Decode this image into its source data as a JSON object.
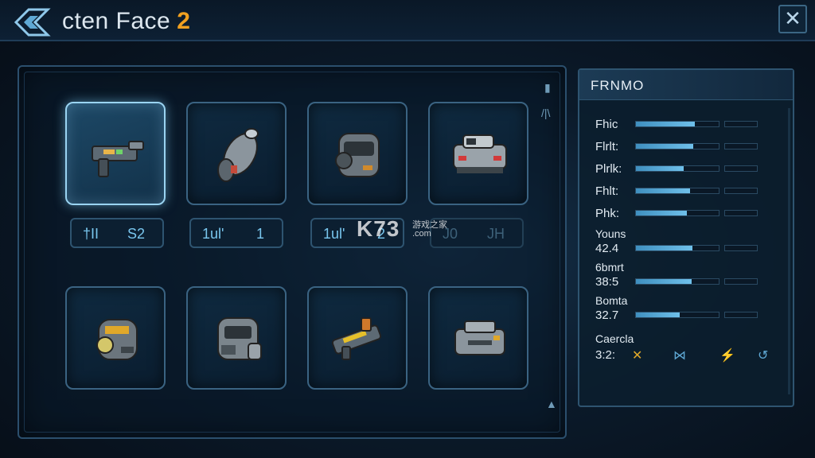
{
  "header": {
    "title": "cten Face",
    "title_number": "2",
    "close_label": "✕"
  },
  "inventory": {
    "slots": [
      {
        "name": "blaster-rifle",
        "selected": true
      },
      {
        "name": "hover-bike"
      },
      {
        "name": "armored-helmet"
      },
      {
        "name": "armored-buggy"
      },
      {
        "name": "visor-helmet"
      },
      {
        "name": "heavy-helmet"
      },
      {
        "name": "yellow-blaster"
      },
      {
        "name": "supply-crate"
      }
    ],
    "slot_stats": [
      {
        "a": "†II",
        "b": "S2"
      },
      {
        "a": "1ul'",
        "b": "1"
      },
      {
        "a": "1ul'",
        "b": "2"
      },
      {
        "a": "J0",
        "b": "JH"
      }
    ],
    "side_icons": [
      "▮",
      "/|\\",
      "▲"
    ]
  },
  "panel": {
    "title": "FRNMO",
    "stats": [
      {
        "label": "Fhic",
        "fill": 0.71
      },
      {
        "label": "Flrlt:",
        "fill": 0.69
      },
      {
        "label": "Plrlk:",
        "fill": 0.58
      },
      {
        "label": "Fhlt:",
        "fill": 0.65
      },
      {
        "label": "Phk:",
        "fill": 0.62
      }
    ],
    "values": [
      {
        "label": "Youns",
        "value": "42.4",
        "fill": 0.68
      },
      {
        "label": "6bmrt",
        "value": "38:5",
        "fill": 0.67
      },
      {
        "label": "Bomta",
        "value": "32.7",
        "fill": 0.53
      }
    ],
    "footer": {
      "label": "Caercla",
      "value": "3:2:",
      "icons": [
        "✕",
        "⋈",
        "⚡",
        "↺"
      ]
    }
  },
  "watermark": {
    "logo": "K73",
    "line1": "游戏之家",
    "line2": ".com"
  },
  "colors": {
    "accent": "#6fc0ea",
    "highlight": "#f0a020",
    "panel_border": "#2e5470"
  }
}
